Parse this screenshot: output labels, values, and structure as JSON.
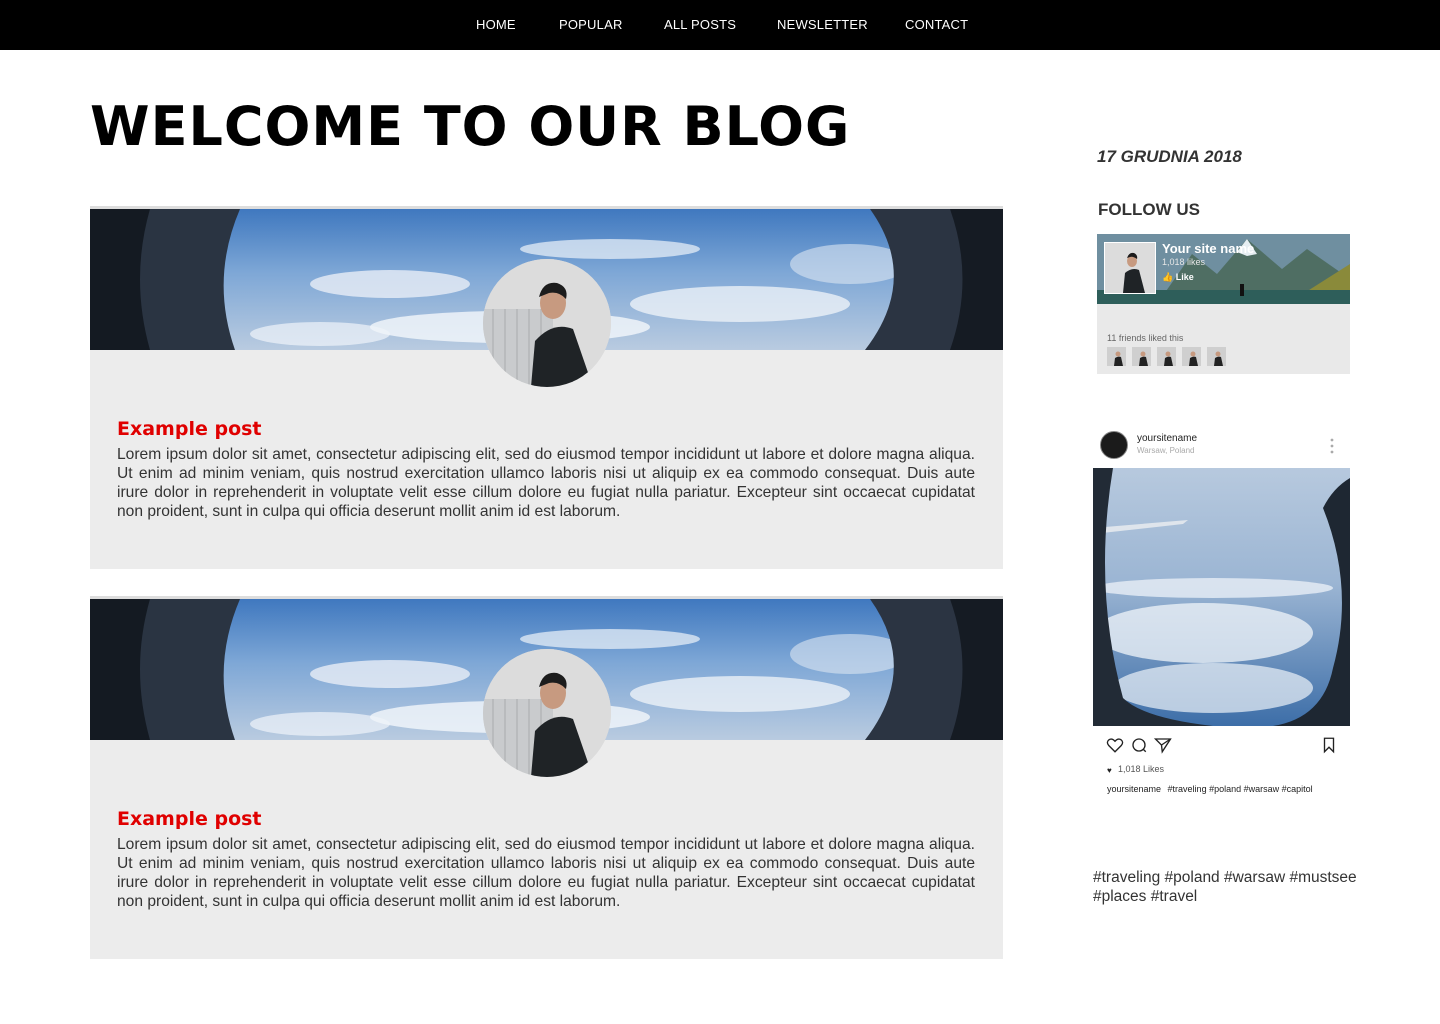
{
  "nav": {
    "items": [
      "HOME",
      "POPULAR",
      "ALL POSTS",
      "NEWSLETTER",
      "CONTACT"
    ]
  },
  "page": {
    "title": "WELCOME TO OUR BLOG"
  },
  "posts": [
    {
      "title": "Example post",
      "body": "Lorem ipsum dolor sit amet, consectetur adipiscing elit, sed do eiusmod tempor incididunt ut labore et dolore magna aliqua. Ut enim ad minim veniam, quis nostrud exercitation ullamco laboris nisi ut aliquip ex ea commodo consequat. Duis aute irure dolor in reprehenderit in voluptate velit esse cillum dolore eu fugiat nulla pariatur. Excepteur sint occaecat cupidatat non proident, sunt in culpa qui officia deserunt mollit anim id est laborum."
    },
    {
      "title": "Example post",
      "body": "Lorem ipsum dolor sit amet, consectetur adipiscing elit, sed do eiusmod tempor incididunt ut labore et dolore magna aliqua. Ut enim ad minim veniam, quis nostrud exercitation ullamco laboris nisi ut aliquip ex ea commodo consequat. Duis aute irure dolor in reprehenderit in voluptate velit esse cillum dolore eu fugiat nulla pariatur. Excepteur sint occaecat cupidatat non proident, sunt in culpa qui officia deserunt mollit anim id est laborum."
    }
  ],
  "sidebar": {
    "date": "17 GRUDNIA 2018",
    "follow_heading": "FOLLOW US",
    "facebook": {
      "page_name": "Your site name",
      "likes": "1,018 likes",
      "like_button": "Like",
      "friends_text": "11 friends liked this",
      "icons": [
        "thumbs-up-icon"
      ]
    },
    "instagram": {
      "username": "yoursitename",
      "location": "Warsaw, Poland",
      "likes": "1,018 Likes",
      "caption_user": "yoursitename",
      "caption_tags": "#traveling #poland #warsaw #capitol",
      "icons": [
        "heart-icon",
        "comment-icon",
        "share-icon",
        "bookmark-icon",
        "more-icon"
      ]
    },
    "tags": "#traveling #poland #warsaw #mustsee #places #travel"
  },
  "colors": {
    "nav_bg": "#000000",
    "accent_red": "#e00000",
    "card_bg": "#ececec",
    "sky_blue": "#5b8fc7"
  }
}
